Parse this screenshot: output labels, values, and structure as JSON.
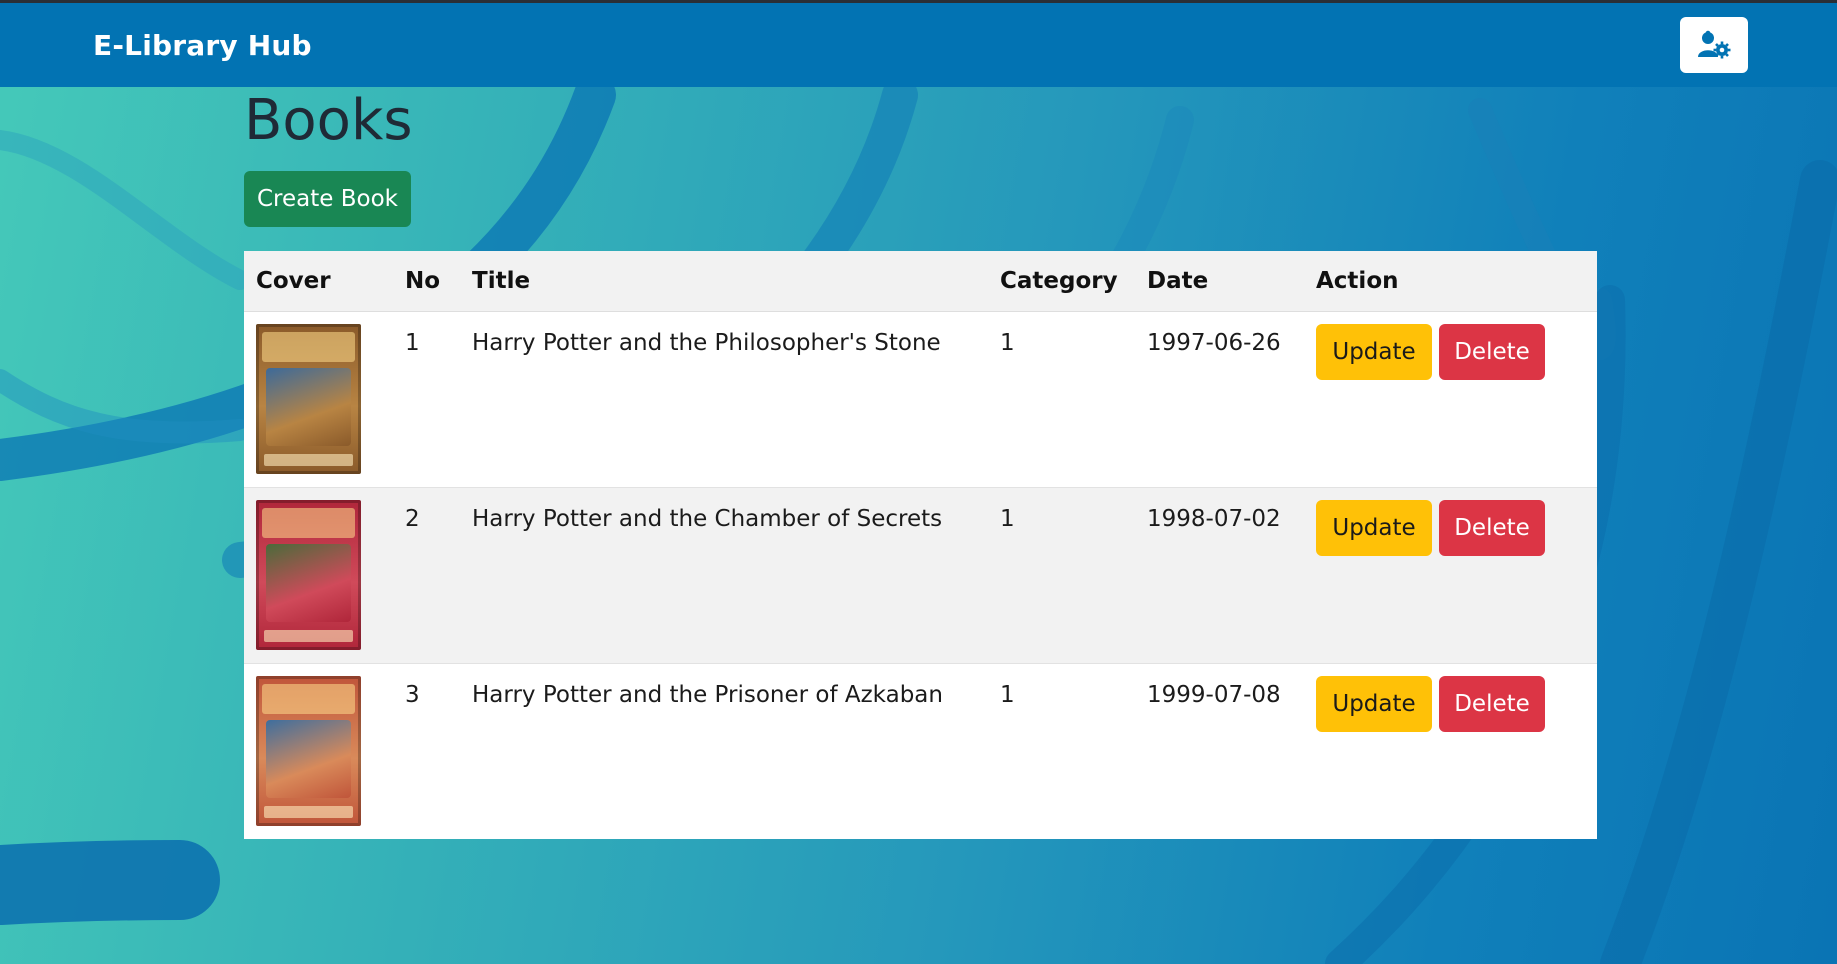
{
  "navbar": {
    "brand": "E-Library Hub",
    "user_icon": "users-gear-icon"
  },
  "page": {
    "title": "Books",
    "create_button": "Create Book"
  },
  "table": {
    "headers": [
      "Cover",
      "No",
      "Title",
      "Category",
      "Date",
      "Action"
    ],
    "rows": [
      {
        "no": "1",
        "title": "Harry Potter and the Philosopher's Stone",
        "category": "1",
        "date": "1997-06-26",
        "update": "Update",
        "delete": "Delete",
        "cover_colors": [
          "#8a5a2a",
          "#b88443",
          "#3c6a9a"
        ]
      },
      {
        "no": "2",
        "title": "Harry Potter and the Chamber of Secrets",
        "category": "1",
        "date": "1998-07-02",
        "update": "Update",
        "delete": "Delete",
        "cover_colors": [
          "#b0263a",
          "#d04a5a",
          "#4a6b3a"
        ]
      },
      {
        "no": "3",
        "title": "Harry Potter and the Prisoner of Azkaban",
        "category": "1",
        "date": "1999-07-08",
        "update": "Update",
        "delete": "Delete",
        "cover_colors": [
          "#c0553a",
          "#d98a5a",
          "#3e6e9e"
        ]
      }
    ]
  },
  "colors": {
    "navbar": "#0273b3",
    "create": "#198754",
    "update": "#ffc107",
    "delete": "#dc3545"
  }
}
